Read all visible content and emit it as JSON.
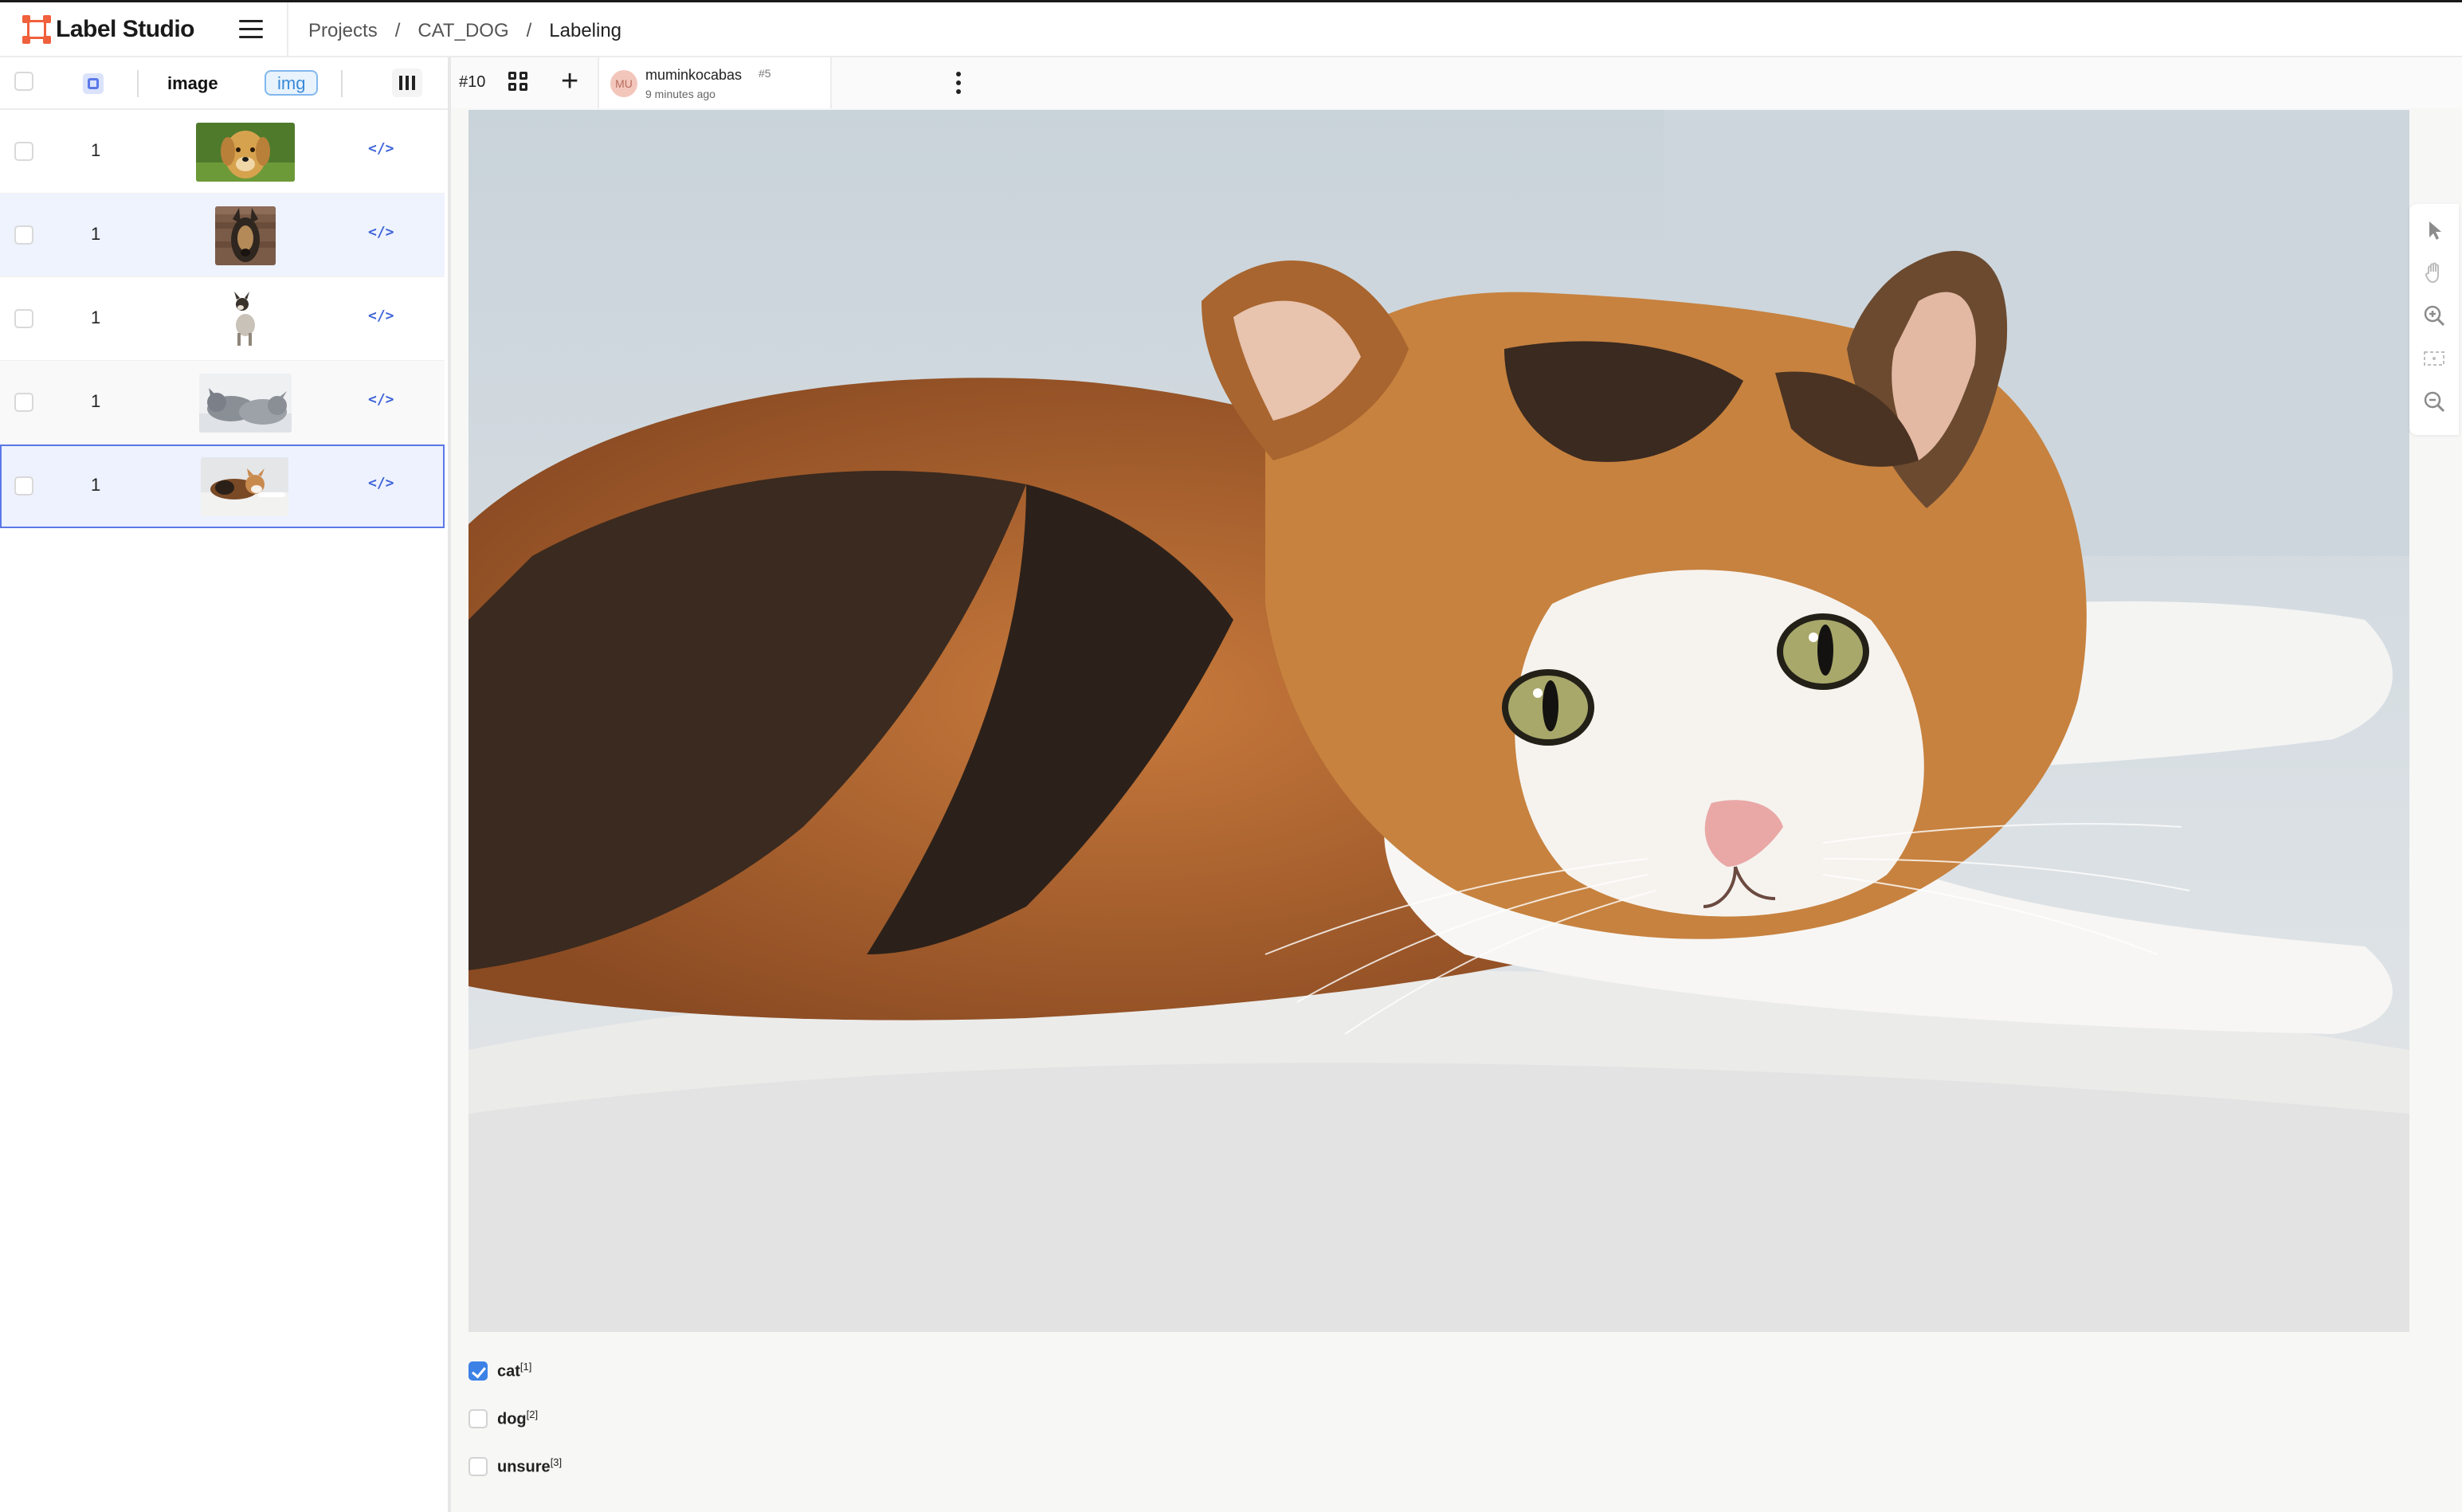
{
  "app": {
    "name": "Label Studio"
  },
  "breadcrumb": [
    "Projects",
    "CAT_DOG",
    "Labeling"
  ],
  "task_table": {
    "columns": [
      "image",
      "img"
    ],
    "rows": [
      {
        "annotations": "1",
        "thumb": "golden-retriever",
        "code_icon": "</>"
      },
      {
        "annotations": "1",
        "thumb": "german-shepherd",
        "code_icon": "</>"
      },
      {
        "annotations": "1",
        "thumb": "small-dog",
        "code_icon": "</>"
      },
      {
        "annotations": "1",
        "thumb": "sleeping-cats",
        "code_icon": "</>"
      },
      {
        "annotations": "1",
        "thumb": "calico-cat",
        "code_icon": "</>"
      }
    ]
  },
  "annotation": {
    "task_id": "#10",
    "user_initials": "MU",
    "user_name": "muminkocabas",
    "annotation_id": "#5",
    "time_ago": "9 minutes ago"
  },
  "choices": [
    {
      "label": "cat",
      "hotkey": "[1]",
      "checked": true
    },
    {
      "label": "dog",
      "hotkey": "[2]",
      "checked": false
    },
    {
      "label": "unsure",
      "hotkey": "[3]",
      "checked": false
    }
  ],
  "image_tools": [
    "pointer-icon",
    "hand-icon",
    "zoom-in-icon",
    "fit-icon",
    "zoom-out-icon"
  ],
  "colors": {
    "accent": "#5b78e8",
    "brand": "#f0603c",
    "checked": "#3c82e6"
  }
}
